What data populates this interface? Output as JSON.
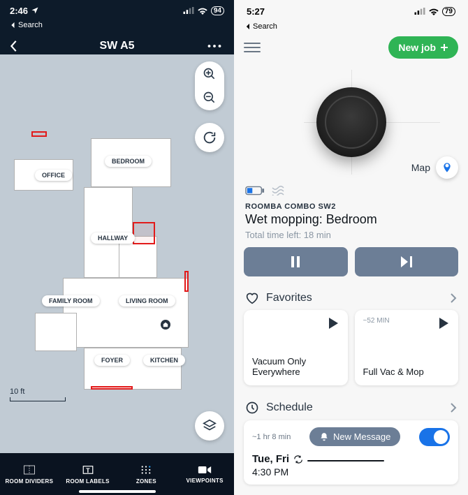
{
  "left": {
    "status": {
      "time": "2:46",
      "back_label": "Search",
      "battery": "94"
    },
    "header": {
      "title": "SW A5"
    },
    "rooms": {
      "office": "OFFICE",
      "bedroom": "BEDROOM",
      "hallway": "HALLWAY",
      "family_room": "FAMILY ROOM",
      "living_room": "LIVING ROOM",
      "foyer": "FOYER",
      "kitchen": "KITCHEN"
    },
    "scale_label": "10 ft",
    "tabs": {
      "dividers": "ROOM DIVIDERS",
      "labels": "ROOM LABELS",
      "zones": "ZONES",
      "viewpoints": "VIEWPOINTS"
    }
  },
  "right": {
    "status": {
      "time": "5:27",
      "back_label": "Search",
      "battery": "79"
    },
    "new_job_label": "New job",
    "map_link_label": "Map",
    "robot_name": "ROOMBA COMBO SW2",
    "task_title": "Wet mopping: Bedroom",
    "time_left": "Total time left: 18 min",
    "favorites": {
      "heading": "Favorites",
      "cards": [
        {
          "time": "",
          "title": "Vacuum Only Everywhere"
        },
        {
          "time": "~52 MIN",
          "title": "Full Vac & Mop"
        }
      ]
    },
    "schedule": {
      "heading": "Schedule",
      "estimate": "~1 hr 8 min",
      "new_message": "New Message",
      "when": "Tue, Fri",
      "time": "4:30 PM"
    }
  }
}
